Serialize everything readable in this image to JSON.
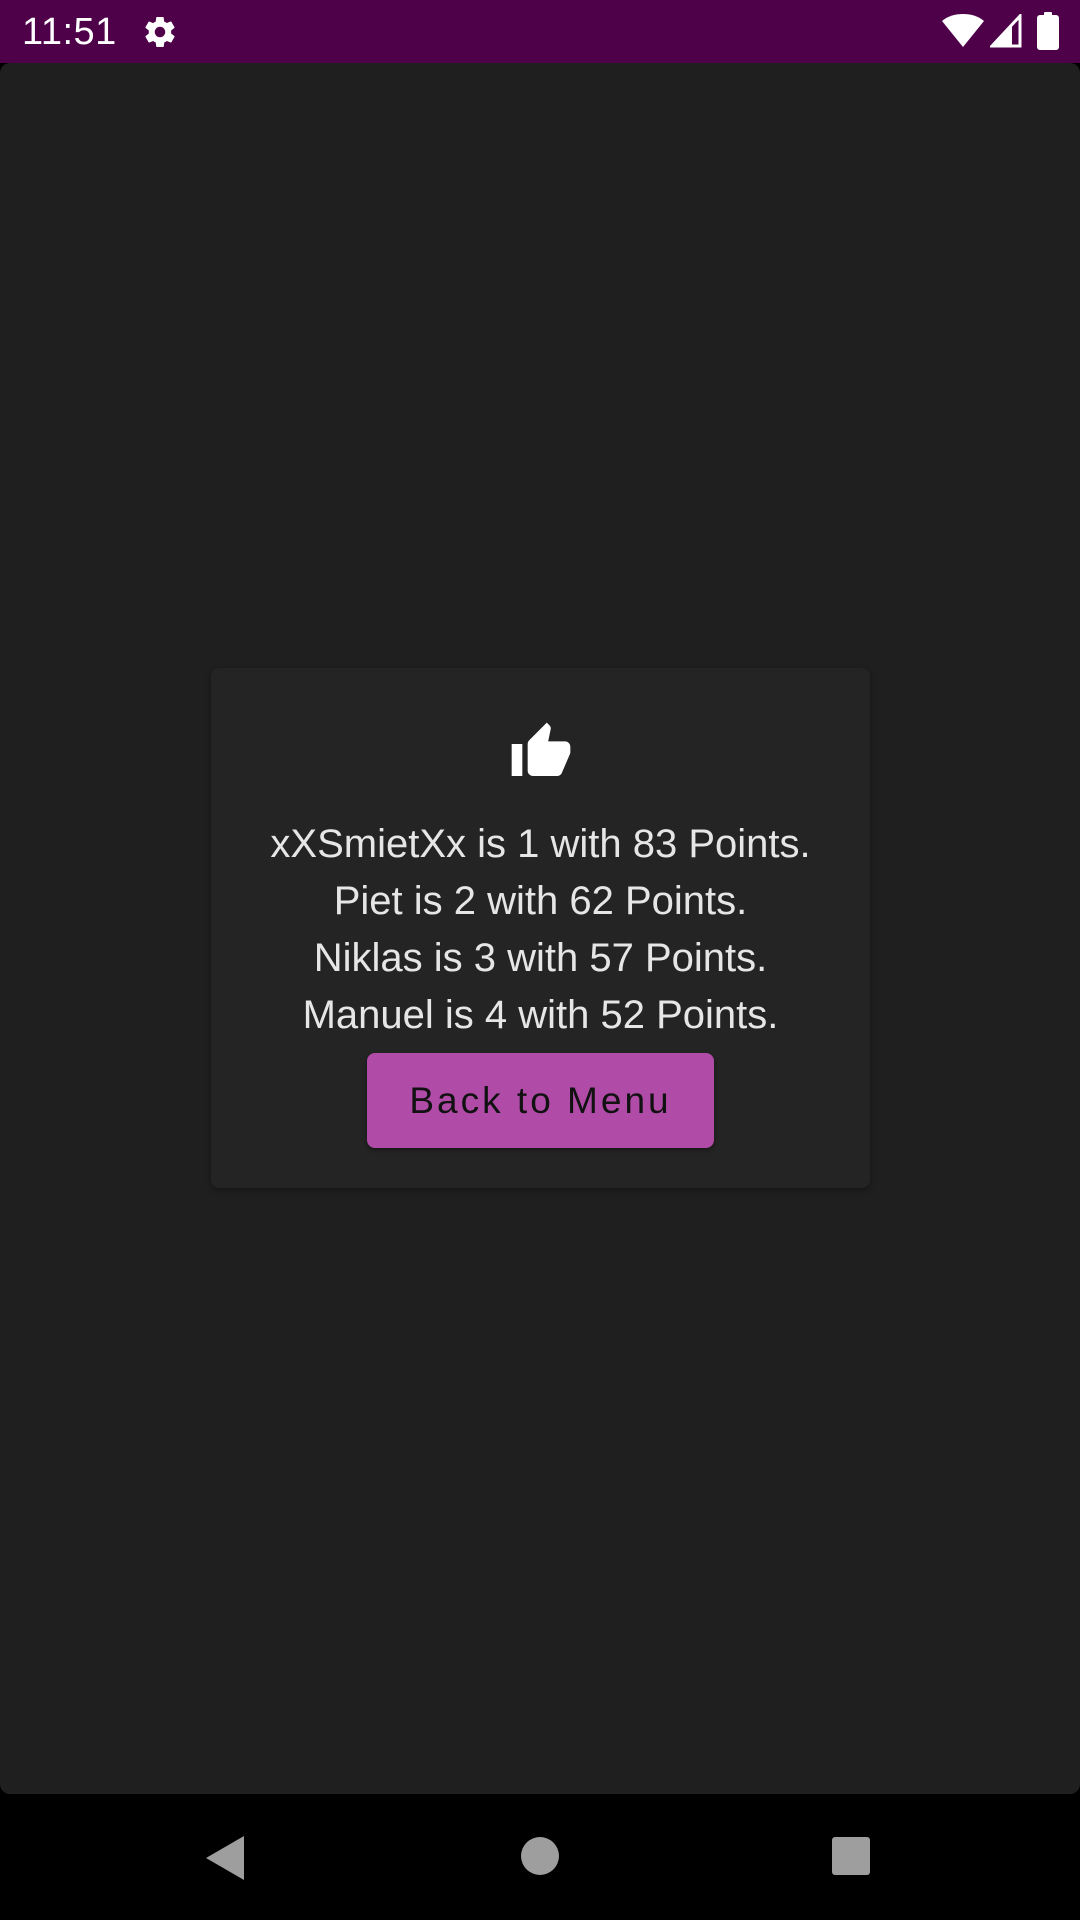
{
  "status_bar": {
    "time": "11:51",
    "background_color": "#4e0049",
    "icons": [
      "gear-icon",
      "wifi-icon",
      "signal-icon",
      "battery-icon"
    ]
  },
  "result_dialog": {
    "icon": "thumbs-up-icon",
    "lines": [
      "xXSmietXx is 1 with 83 Points.",
      "Piet is 2 with 62 Points.",
      "Niklas is 3 with 57 Points.",
      "Manuel is 4 with 52 Points."
    ],
    "back_button_label": "Back to Menu",
    "button_color": "#b04ca8",
    "card_color": "#242424"
  },
  "nav_bar": {
    "icons": [
      "back-icon",
      "home-icon",
      "recents-icon"
    ]
  },
  "colors": {
    "app_background": "#1f1f1f",
    "text": "#e6e6e6"
  }
}
